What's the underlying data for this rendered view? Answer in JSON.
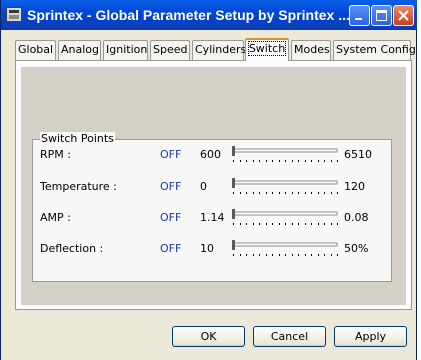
{
  "window": {
    "title": "Sprintex - Global Parameter Setup   by Sprintex ...",
    "icon": "app-icon"
  },
  "caption_buttons": [
    "minimize-icon",
    "maximize-icon",
    "close-icon"
  ],
  "tabs": [
    {
      "label": "Global"
    },
    {
      "label": "Analog"
    },
    {
      "label": "Ignition"
    },
    {
      "label": "Speed"
    },
    {
      "label": "Cylinders"
    },
    {
      "label": "Switch",
      "active": true
    },
    {
      "label": "Modes"
    },
    {
      "label": "System Config"
    }
  ],
  "switch_points": {
    "group_title": "Switch Points",
    "rows": [
      {
        "label": "RPM :",
        "state": "OFF",
        "value": "600",
        "max": "6510",
        "slider_level": 0
      },
      {
        "label": "Temperature :",
        "state": "OFF",
        "value": "0",
        "max": "120",
        "slider_level": 0
      },
      {
        "label": "AMP :",
        "state": "OFF",
        "value": "1.14",
        "max": "0.08",
        "slider_level": 0
      },
      {
        "label": "Deflection :",
        "state": "OFF",
        "value": "10",
        "max": "50%",
        "slider_level": 0
      }
    ]
  },
  "buttons": {
    "ok": "OK",
    "cancel": "Cancel",
    "apply": "Apply"
  },
  "colors": {
    "titlebar": "#0a5fe6",
    "state_text": "#1a3aa8",
    "active_tab_accent": "#e68b2c",
    "close_button": "#c8401c"
  }
}
